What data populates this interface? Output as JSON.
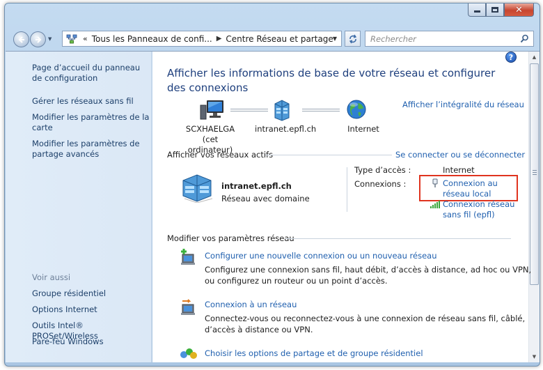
{
  "window": {
    "caption_buttons": [
      "minimize",
      "maximize",
      "close"
    ],
    "close_glyph": "✕"
  },
  "navbar": {
    "breadcrumb_prefix": "«",
    "breadcrumb_1": "Tous les Panneaux de confi...",
    "breadcrumb_2": "Centre Réseau et partage",
    "search_placeholder": "Rechercher"
  },
  "sidebar": {
    "links": [
      "Page d’accueil du panneau de configuration",
      "Gérer les réseaux sans fil",
      "Modifier les paramètres de la carte",
      "Modifier les paramètres de partage avancés"
    ],
    "see_also_title": "Voir aussi",
    "see_also": [
      "Groupe résidentiel",
      "Options Internet",
      "Outils Intel® PROSet/Wireless",
      "Pare-feu Windows"
    ]
  },
  "main": {
    "help": "?",
    "title": "Afficher les informations de base de votre réseau et configurer des connexions",
    "map": {
      "computer_name": "SCXHAELGA",
      "computer_sub": "(cet ordinateur)",
      "network": "intranet.epfl.ch",
      "internet": "Internet",
      "full_map_link": "Afficher l’intégralité du réseau"
    },
    "active": {
      "header": "Afficher vos réseaux actifs",
      "connect_link": "Se connecter ou se déconnecter",
      "network_name": "intranet.epfl.ch",
      "network_type": "Réseau avec domaine",
      "access_label": "Type d’accès :",
      "access_value": "Internet",
      "connections_label": "Connexions :",
      "connection_1_line1": "Connexion au",
      "connection_1_line2": "réseau local",
      "connection_2_line1": "Connexion réseau",
      "connection_2_line2": "sans fil (epfl)"
    },
    "settings": {
      "header": "Modifier vos paramètres réseau",
      "items": [
        {
          "link": "Configurer une nouvelle connexion ou un nouveau réseau",
          "desc1": "Configurez une connexion sans fil, haut débit, d’accès à distance, ad hoc ou VPN,",
          "desc2": "ou configurez un routeur ou un point d’accès."
        },
        {
          "link": "Connexion à un réseau",
          "desc1": "Connectez-vous ou reconnectez-vous à une connexion de réseau sans fil, câblé,",
          "desc2": "d’accès à distance ou VPN."
        },
        {
          "link": "Choisir les options de partage et de groupe résidentiel"
        }
      ]
    }
  },
  "colors": {
    "link": "#1f5fae",
    "title": "#1e3f7d",
    "highlight_box": "#e0341f"
  }
}
